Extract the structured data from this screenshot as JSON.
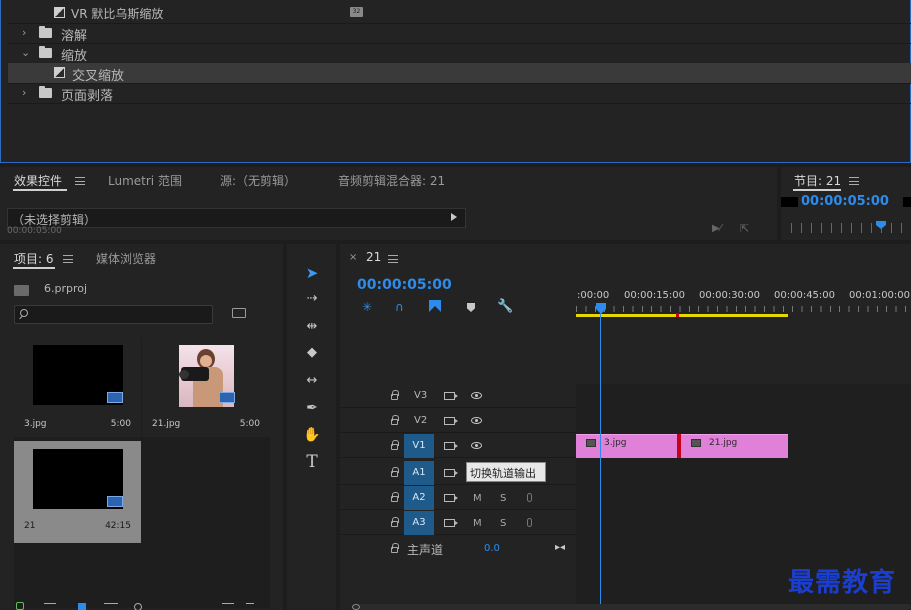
{
  "effects_tree": {
    "items": [
      {
        "label": "VR 默比乌斯缩放",
        "kind": "effect",
        "indent": 2
      },
      {
        "label": "溶解",
        "kind": "folder",
        "expanded": false,
        "indent": 1
      },
      {
        "label": "缩放",
        "kind": "folder",
        "expanded": true,
        "indent": 1
      },
      {
        "label": "交叉缩放",
        "kind": "effect",
        "indent": 2,
        "selected": true
      },
      {
        "label": "页面剥落",
        "kind": "folder",
        "expanded": false,
        "indent": 1
      }
    ],
    "badge": "32"
  },
  "top_tabs": {
    "effect_controls": "效果控件",
    "lumetri": "Lumetri 范围",
    "source": "源:（无剪辑）",
    "audio_mixer": "音频剪辑混合器: 21",
    "program": "节目: 21"
  },
  "effect_controls": {
    "no_clip": "（未选择剪辑）",
    "timecode": "00:00:05:00"
  },
  "program": {
    "timecode": "00:00:05:00"
  },
  "project": {
    "tab_label": "项目: 6",
    "media_browser": "媒体浏览器",
    "file_name": "6.prproj",
    "search_placeholder": "",
    "items": [
      {
        "name": "3.jpg",
        "duration": "5:00"
      },
      {
        "name": "21.jpg",
        "duration": "5:00"
      },
      {
        "name": "21",
        "duration": "42:15"
      }
    ]
  },
  "timeline": {
    "sequence_name": "21",
    "timecode": "00:00:05:00",
    "ruler": [
      ":00:00",
      "00:00:15:00",
      "00:00:30:00",
      "00:00:45:00",
      "00:01:00:00"
    ],
    "tracks": [
      {
        "label": "V3"
      },
      {
        "label": "V2"
      },
      {
        "label": "V1",
        "patch": "V1"
      },
      {
        "label": "A1",
        "patch": "A1"
      },
      {
        "label": "A2",
        "patch": "A2",
        "m": "M",
        "s": "S"
      },
      {
        "label": "A3",
        "patch": "A3",
        "m": "M",
        "s": "S"
      }
    ],
    "master_label": "主声道",
    "master_value": "0.0",
    "tooltip": "切换轨道输出",
    "clips": [
      {
        "name": "3.jpg"
      },
      {
        "name": "21.jpg"
      }
    ]
  },
  "watermark": "最需教育",
  "colors": {
    "accent_blue": "#2d8ceb",
    "clip_pink": "#e080d8",
    "work_area_yellow": "#e8d800",
    "watermark_blue": "#1a3fd0"
  }
}
